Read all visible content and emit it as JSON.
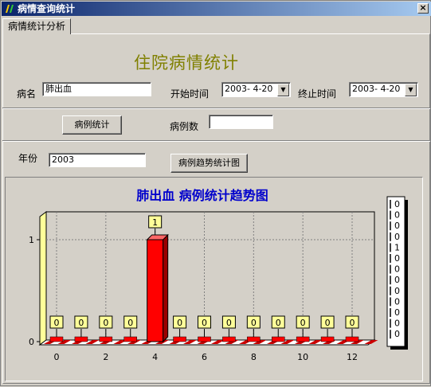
{
  "window": {
    "title": "病情查询统计",
    "close_label": "×"
  },
  "tab": {
    "label": "病情统计分析"
  },
  "form": {
    "heading": "住院病情统计",
    "disease_label": "病名",
    "disease_value": "肺出血",
    "start_label": "开始时间",
    "start_value": "2003- 4-20",
    "end_label": "终止时间",
    "end_value": "2003- 4-20",
    "case_stats_button": "病例统计",
    "case_count_label": "病例数",
    "case_count_value": "",
    "year_label": "年份",
    "year_value": "2003",
    "trend_button": "病例趋势统计图"
  },
  "chart_data": {
    "type": "bar",
    "title": "肺出血 病例统计趋势图",
    "x": [
      0,
      1,
      2,
      3,
      4,
      5,
      6,
      7,
      8,
      9,
      10,
      11,
      12
    ],
    "values": [
      0,
      0,
      0,
      0,
      1,
      0,
      0,
      0,
      0,
      0,
      0,
      0,
      0
    ],
    "x_ticks": [
      "0",
      "2",
      "4",
      "6",
      "8",
      "10",
      "12"
    ],
    "y_ticks": [
      "0",
      "1"
    ],
    "ylim": [
      0,
      1
    ],
    "data_labels": [
      "0",
      "0",
      "0",
      "0",
      "1",
      "0",
      "0",
      "0",
      "0",
      "0",
      "0",
      "0",
      "0"
    ],
    "legend": [
      "0",
      "0",
      "0",
      "0",
      "1",
      "0",
      "0",
      "0",
      "0",
      "0",
      "0",
      "0",
      "0"
    ],
    "legend_placement": "right",
    "bar_color": "#ff0000",
    "grid": true
  }
}
